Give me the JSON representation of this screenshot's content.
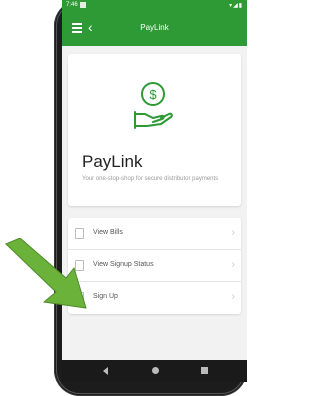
{
  "colors": {
    "primary": "#2d9a35",
    "arrow": "#6ab23a"
  },
  "status_bar": {
    "time": "7:46",
    "indicators": "▾◢▮"
  },
  "app_bar": {
    "title": "PayLink",
    "menu_icon": "hamburger-icon",
    "back_icon": "back-chevron-icon"
  },
  "card": {
    "title": "PayLink",
    "subtitle": "Your one-stop-shop for secure distributor payments",
    "logo_icon": "hand-dollar-coin-icon"
  },
  "list": {
    "items": [
      {
        "label": "View Bills",
        "icon": "document-icon"
      },
      {
        "label": "View Signup Status",
        "icon": "clipboard-icon"
      },
      {
        "label": "Sign Up",
        "icon": "sign-up-icon"
      }
    ]
  },
  "overlay": {
    "arrow": "pointer-arrow-icon"
  }
}
